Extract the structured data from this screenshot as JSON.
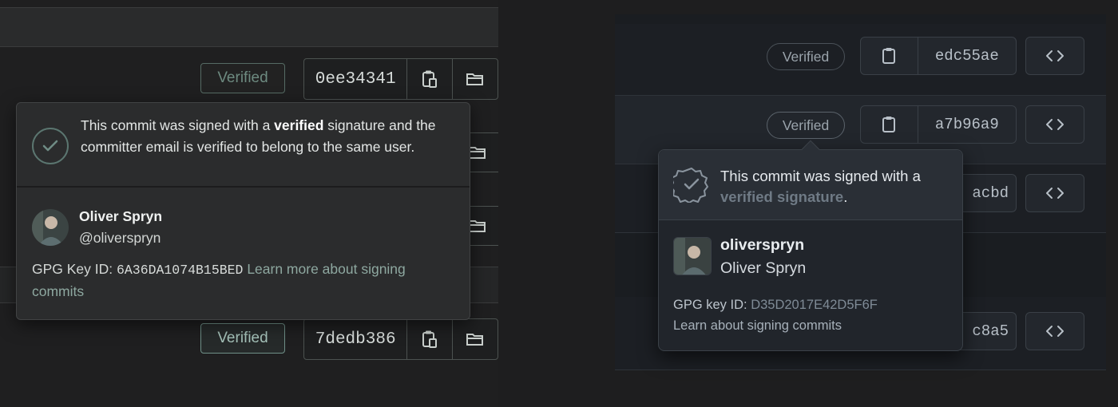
{
  "left": {
    "rows": [
      {
        "badge": "Verified",
        "sha": "0ee34341",
        "style": "dim"
      },
      {
        "badge": "Verified",
        "sha": "7dedb386",
        "style": "bright"
      }
    ],
    "popover": {
      "message_pre": "This commit was signed with a ",
      "message_bold": "verified",
      "message_post": " signature and the committer email is verified to belong to the same user.",
      "user_name": "Oliver Spryn",
      "user_handle": "@oliverspryn",
      "gpg_label": "GPG Key ID: ",
      "gpg_key": "6A36DA1074B15BED",
      "learn_more": "Learn more about signing commits"
    }
  },
  "right": {
    "rows": [
      {
        "badge": "Verified",
        "sha": "edc55ae"
      },
      {
        "badge": "Verified",
        "sha": "a7b96a9"
      }
    ],
    "partial_shas": [
      "acbd",
      "c8a5"
    ],
    "popover": {
      "message_pre": "This commit was signed with a ",
      "message_link": "verified signature",
      "message_post": ".",
      "login": "oliverspryn",
      "name": "Oliver Spryn",
      "gpg_label": "GPG key ID: ",
      "gpg_key": "D35D2017E42D5F6F",
      "learn": "Learn about signing commits"
    }
  },
  "colors": {
    "left_accent": "#6f9088",
    "right_badge_border": "#4a5158",
    "background": "#1e1e1f"
  }
}
